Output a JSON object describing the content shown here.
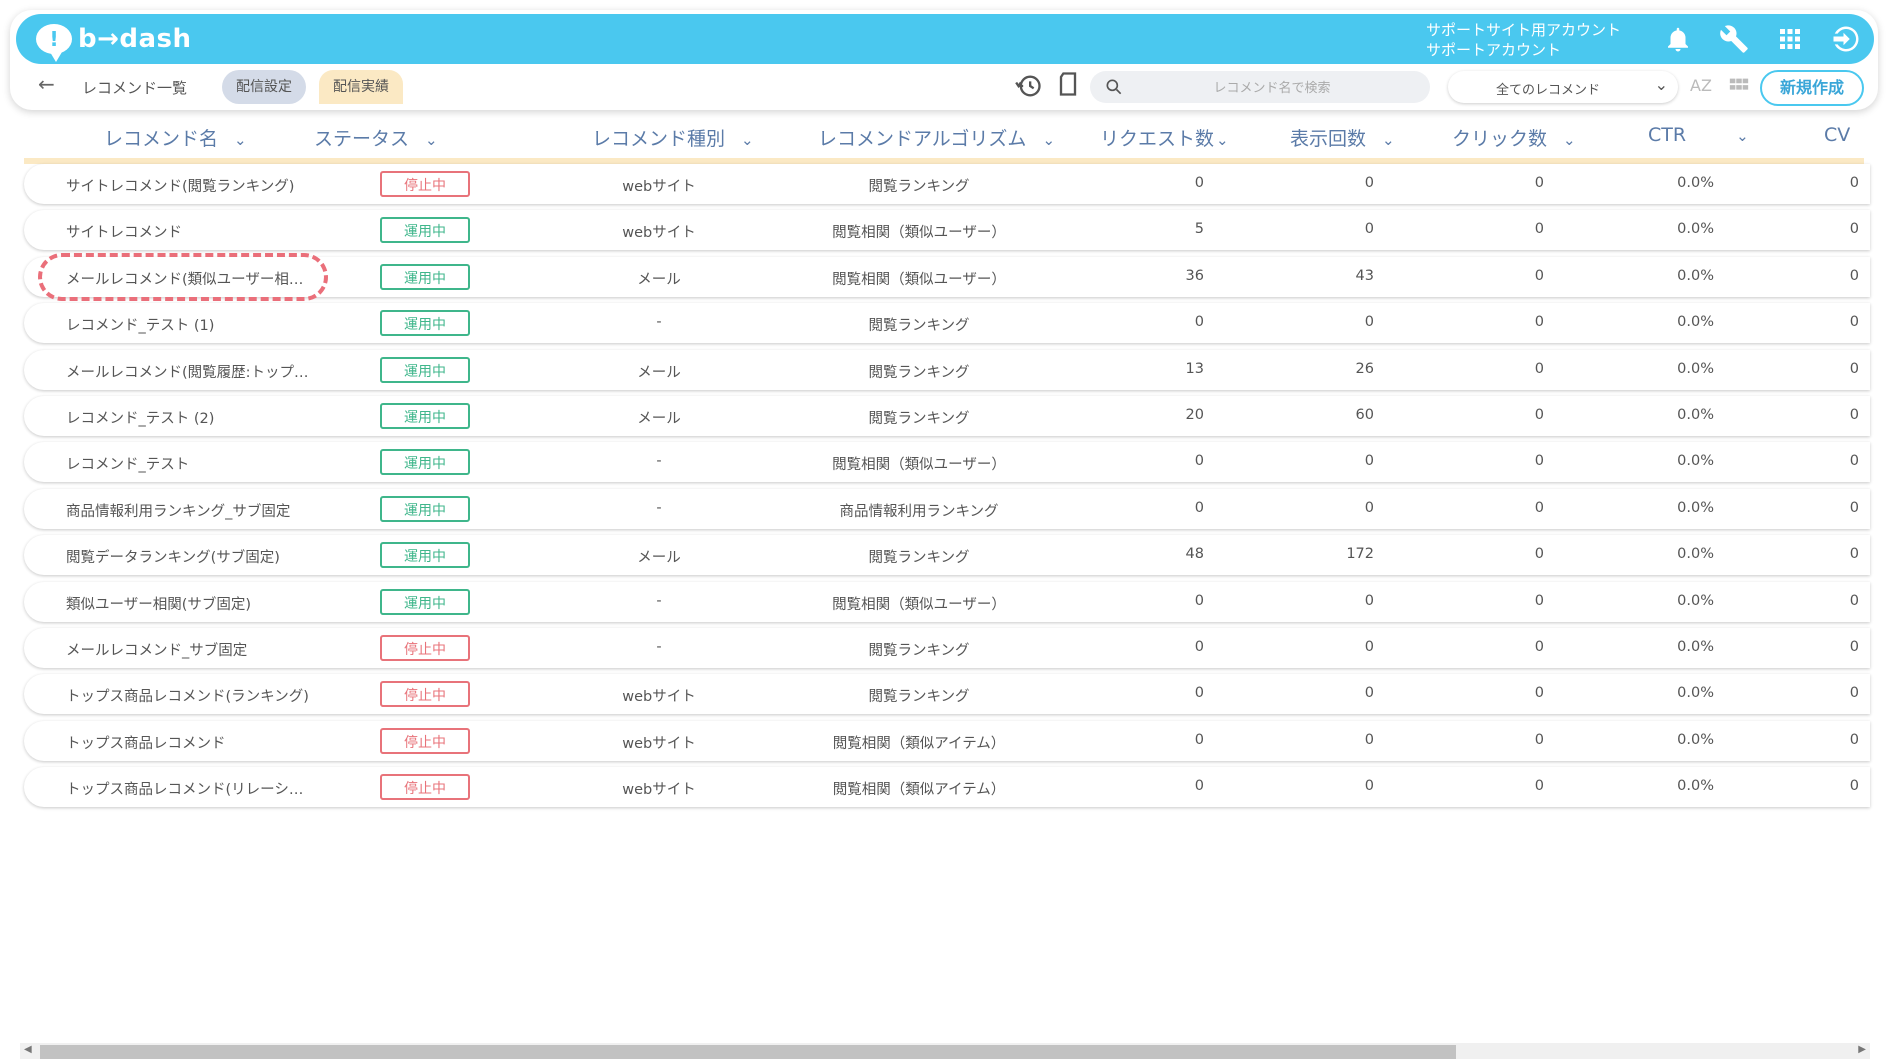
{
  "app": {
    "logo_text": "b→dash"
  },
  "account": {
    "line1": "サポートサイト用アカウント",
    "line2": "サポートアカウント"
  },
  "toolbar": {
    "breadcrumb": "レコメンド一覧",
    "tab_settings": "配信設定",
    "tab_results": "配信実績",
    "search_placeholder": "レコメンド名で検索",
    "filter_selected": "全てのレコメンド",
    "sort_label": "AZ",
    "new_button": "新規作成"
  },
  "columns": [
    "レコメンド名",
    "ステータス",
    "レコメンド種別",
    "レコメンドアルゴリズム",
    "リクエスト数",
    "表示回数",
    "クリック数",
    "CTR",
    "CV"
  ],
  "rows": [
    {
      "name": "サイトレコメンド(閲覧ランキング)",
      "status": "停止中",
      "type": "webサイト",
      "algo": "閲覧ランキング",
      "req": "0",
      "disp": "0",
      "click": "0",
      "ctr": "0.0%",
      "cv": "0"
    },
    {
      "name": "サイトレコメンド",
      "status": "運用中",
      "type": "webサイト",
      "algo": "閲覧相関（類似ユーザー）",
      "req": "5",
      "disp": "0",
      "click": "0",
      "ctr": "0.0%",
      "cv": "0"
    },
    {
      "name": "メールレコメンド(類似ユーザー相…",
      "status": "運用中",
      "type": "メール",
      "algo": "閲覧相関（類似ユーザー）",
      "req": "36",
      "disp": "43",
      "click": "0",
      "ctr": "0.0%",
      "cv": "0"
    },
    {
      "name": "レコメンド_テスト (1)",
      "status": "運用中",
      "type": "-",
      "algo": "閲覧ランキング",
      "req": "0",
      "disp": "0",
      "click": "0",
      "ctr": "0.0%",
      "cv": "0"
    },
    {
      "name": "メールレコメンド(閲覧履歴:トップ…",
      "status": "運用中",
      "type": "メール",
      "algo": "閲覧ランキング",
      "req": "13",
      "disp": "26",
      "click": "0",
      "ctr": "0.0%",
      "cv": "0"
    },
    {
      "name": "レコメンド_テスト (2)",
      "status": "運用中",
      "type": "メール",
      "algo": "閲覧ランキング",
      "req": "20",
      "disp": "60",
      "click": "0",
      "ctr": "0.0%",
      "cv": "0"
    },
    {
      "name": "レコメンド_テスト",
      "status": "運用中",
      "type": "-",
      "algo": "閲覧相関（類似ユーザー）",
      "req": "0",
      "disp": "0",
      "click": "0",
      "ctr": "0.0%",
      "cv": "0"
    },
    {
      "name": "商品情報利用ランキング_サブ固定",
      "status": "運用中",
      "type": "-",
      "algo": "商品情報利用ランキング",
      "req": "0",
      "disp": "0",
      "click": "0",
      "ctr": "0.0%",
      "cv": "0"
    },
    {
      "name": "閲覧データランキング(サブ固定)",
      "status": "運用中",
      "type": "メール",
      "algo": "閲覧ランキング",
      "req": "48",
      "disp": "172",
      "click": "0",
      "ctr": "0.0%",
      "cv": "0"
    },
    {
      "name": "類似ユーザー相関(サブ固定)",
      "status": "運用中",
      "type": "-",
      "algo": "閲覧相関（類似ユーザー）",
      "req": "0",
      "disp": "0",
      "click": "0",
      "ctr": "0.0%",
      "cv": "0"
    },
    {
      "name": "メールレコメンド_サブ固定",
      "status": "停止中",
      "type": "-",
      "algo": "閲覧ランキング",
      "req": "0",
      "disp": "0",
      "click": "0",
      "ctr": "0.0%",
      "cv": "0"
    },
    {
      "name": "トップス商品レコメンド(ランキング)",
      "status": "停止中",
      "type": "webサイト",
      "algo": "閲覧ランキング",
      "req": "0",
      "disp": "0",
      "click": "0",
      "ctr": "0.0%",
      "cv": "0"
    },
    {
      "name": "トップス商品レコメンド",
      "status": "停止中",
      "type": "webサイト",
      "algo": "閲覧相関（類似アイテム）",
      "req": "0",
      "disp": "0",
      "click": "0",
      "ctr": "0.0%",
      "cv": "0"
    },
    {
      "name": "トップス商品レコメンド(リレーシ…",
      "status": "停止中",
      "type": "webサイト",
      "algo": "閲覧相関（類似アイテム）",
      "req": "0",
      "disp": "0",
      "click": "0",
      "ctr": "0.0%",
      "cv": "0"
    }
  ],
  "colors": {
    "accent": "#4ac8ef",
    "running": "#3fb68b",
    "stopped": "#e8737a",
    "highlight": "#ea6f7a"
  }
}
